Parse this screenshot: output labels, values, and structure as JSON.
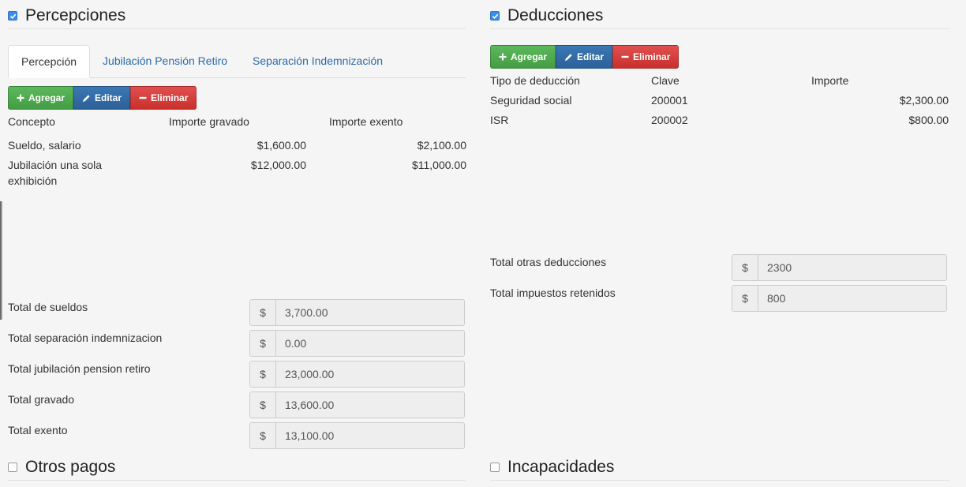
{
  "percepciones": {
    "checked": true,
    "title": "Percepciones",
    "tabs": [
      {
        "label": "Percepción",
        "active": true
      },
      {
        "label": "Jubilación Pensión Retiro",
        "active": false
      },
      {
        "label": "Separación Indemnización",
        "active": false
      }
    ],
    "buttons": {
      "add": "Agregar",
      "edit": "Editar",
      "delete": "Eliminar"
    },
    "columns": [
      "Concepto",
      "Importe gravado",
      "Importe exento"
    ],
    "rows": [
      {
        "concepto": "Sueldo, salario",
        "gravado": "$1,600.00",
        "exento": "$2,100.00"
      },
      {
        "concepto_line1": "Jubilación una sola",
        "concepto_line2": "exhibición",
        "gravado": "$12,000.00",
        "exento": "$11,000.00"
      }
    ],
    "totals": [
      {
        "label": "Total de sueldos",
        "currency": "$",
        "value": "3,700.00"
      },
      {
        "label": "Total separación indemnizacion",
        "currency": "$",
        "value": "0.00"
      },
      {
        "label": "Total jubilación pension retiro",
        "currency": "$",
        "value": "23,000.00"
      },
      {
        "label": "Total gravado",
        "currency": "$",
        "value": "13,600.00"
      },
      {
        "label": "Total exento",
        "currency": "$",
        "value": "13,100.00"
      }
    ]
  },
  "deducciones": {
    "checked": true,
    "title": "Deducciones",
    "buttons": {
      "add": "Agregar",
      "edit": "Editar",
      "delete": "Eliminar"
    },
    "columns": [
      "Tipo de deducción",
      "Clave",
      "Importe"
    ],
    "rows": [
      {
        "tipo": "Seguridad social",
        "clave": "200001",
        "importe": "$2,300.00"
      },
      {
        "tipo": "ISR",
        "clave": "200002",
        "importe": "$800.00"
      }
    ],
    "totals": [
      {
        "label": "Total otras deducciones",
        "currency": "$",
        "value": "2300"
      },
      {
        "label": "Total impuestos retenidos",
        "currency": "$",
        "value": "800"
      }
    ]
  },
  "otros_pagos": {
    "checked": false,
    "title": "Otros pagos"
  },
  "incapacidades": {
    "checked": false,
    "title": "Incapacidades"
  },
  "colors": {
    "checkbox_checked": "#3b8cf0",
    "add": "#5cb85c",
    "edit": "#3a78b5",
    "delete": "#d9534f",
    "link": "#2a6ab0"
  }
}
